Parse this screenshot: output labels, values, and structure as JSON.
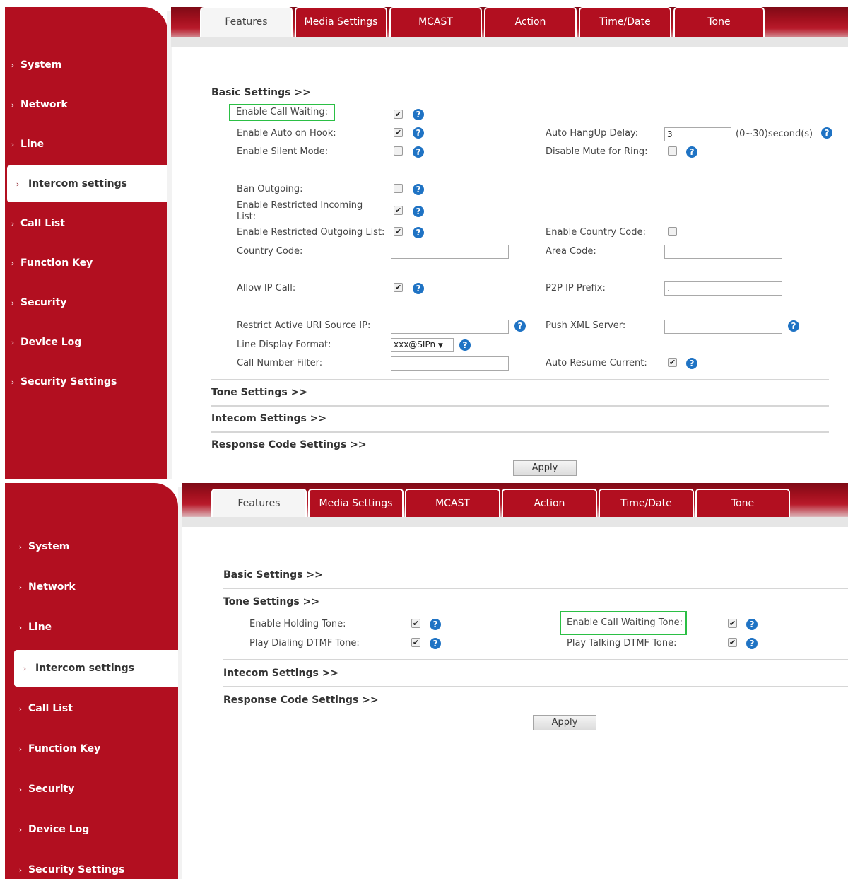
{
  "sidebar": {
    "items": [
      {
        "label": "System"
      },
      {
        "label": "Network"
      },
      {
        "label": "Line"
      },
      {
        "label": "Intercom settings"
      },
      {
        "label": "Call List"
      },
      {
        "label": "Function Key"
      },
      {
        "label": "Security"
      },
      {
        "label": "Device Log"
      },
      {
        "label": "Security Settings"
      }
    ],
    "chevron": "›",
    "active_chevron": "›"
  },
  "tabs": [
    {
      "label": "Features"
    },
    {
      "label": "Media Settings"
    },
    {
      "label": "MCAST"
    },
    {
      "label": "Action"
    },
    {
      "label": "Time/Date"
    },
    {
      "label": "Tone"
    }
  ],
  "sections": {
    "basic": "Basic Settings >>",
    "tone": "Tone Settings >>",
    "intercom": "Intecom Settings >>",
    "response": "Response Code Settings >>"
  },
  "basic": {
    "enable_call_waiting": {
      "label": "Enable Call Waiting:",
      "checked": "✔"
    },
    "enable_auto_on_hook": {
      "label": "Enable Auto on Hook:",
      "checked": "✔"
    },
    "auto_hangup_delay": {
      "label": "Auto HangUp Delay:",
      "value": "3",
      "unit": "(0~30)second(s)"
    },
    "enable_silent_mode": {
      "label": "Enable Silent Mode:",
      "checked": ""
    },
    "disable_mute_for_ring": {
      "label": "Disable Mute for Ring:",
      "checked": ""
    },
    "ban_outgoing": {
      "label": "Ban Outgoing:",
      "checked": ""
    },
    "enable_restricted_incoming": {
      "label": "Enable Restricted Incoming List:",
      "checked": "✔"
    },
    "enable_restricted_outgoing": {
      "label": "Enable Restricted Outgoing List:",
      "checked": "✔"
    },
    "enable_country_code": {
      "label": "Enable Country Code:",
      "checked": ""
    },
    "country_code": {
      "label": "Country Code:",
      "value": ""
    },
    "area_code": {
      "label": "Area Code:",
      "value": ""
    },
    "allow_ip_call": {
      "label": "Allow IP Call:",
      "checked": "✔"
    },
    "p2p_ip_prefix": {
      "label": "P2P IP Prefix:",
      "value": "."
    },
    "restrict_active_uri": {
      "label": "Restrict Active URI Source IP:",
      "value": ""
    },
    "push_xml_server": {
      "label": "Push XML Server:",
      "value": ""
    },
    "line_display_format": {
      "label": "Line Display Format:",
      "value": "xxx@SIPn"
    },
    "call_number_filter": {
      "label": "Call Number Filter:",
      "value": ""
    },
    "auto_resume_current": {
      "label": "Auto Resume Current:",
      "checked": "✔"
    }
  },
  "tone": {
    "enable_holding_tone": {
      "label": "Enable Holding Tone:",
      "checked": "✔"
    },
    "enable_call_waiting_tone": {
      "label": "Enable Call Waiting Tone:",
      "checked": "✔"
    },
    "play_dialing_dtmf": {
      "label": "Play Dialing DTMF Tone:",
      "checked": "✔"
    },
    "play_talking_dtmf": {
      "label": "Play Talking DTMF Tone:",
      "checked": "✔"
    }
  },
  "help_glyph": "?",
  "select_arrow": "▼",
  "apply_label": "Apply",
  "colors": {
    "brand_red": "#b20f20",
    "highlight": "#2bbf45",
    "help_blue": "#1f73c4"
  }
}
